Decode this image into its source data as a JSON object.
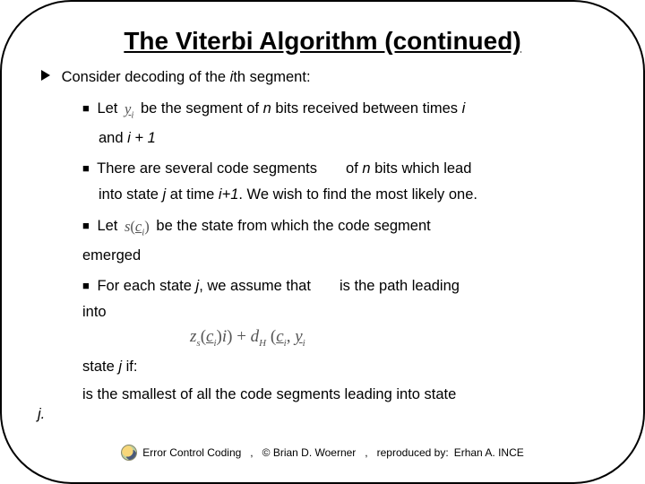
{
  "title": "The Viterbi Algorithm (continued)",
  "lead": {
    "pre": "Consider decoding of the ",
    "ith": "i",
    "post": "th segment:"
  },
  "b1": {
    "pre": "Let ",
    "sym": "y",
    "sub": "i",
    "mid": " be the segment of ",
    "n": "n",
    "post": " bits received between times ",
    "i": "i",
    "cont_pre": "and ",
    "cont_expr": "i + 1"
  },
  "b2": {
    "pre": "There are several code segments",
    "mid": " of ",
    "n": "n",
    "post": " bits which lead",
    "cont_pre": "into state ",
    "j": "j",
    "at": " at time ",
    "ip1": "i+1",
    "rest": ". We wish to find the most likely one."
  },
  "b3": {
    "pre": "Let ",
    "sym1": "s",
    "sym2": "c",
    "sub": "i",
    "mid": " be the state from which the code segment ",
    "emerged": "emerged"
  },
  "b4": {
    "pre": " For each state ",
    "j": "j",
    "mid": ", we assume that ",
    "post": " is the path leading",
    "into": "into"
  },
  "stateJ": {
    "pre": "state ",
    "j": "j",
    "post": " if:"
  },
  "eq": {
    "z": "z",
    "s": "s",
    "lp": "(",
    "c": "c",
    "i": "i",
    "rp": ")",
    "plus": "+",
    "d": "d",
    "H": "H",
    "comma": ",",
    "y": "y"
  },
  "last": {
    "pre": "is the smallest of all the code segments leading into state"
  },
  "jline": "j.",
  "footer": {
    "a": "Error Control Coding",
    "b": "© Brian D. Woerner",
    "c_pre": "reproduced by:",
    "c_name": "Erhan A. INCE"
  }
}
